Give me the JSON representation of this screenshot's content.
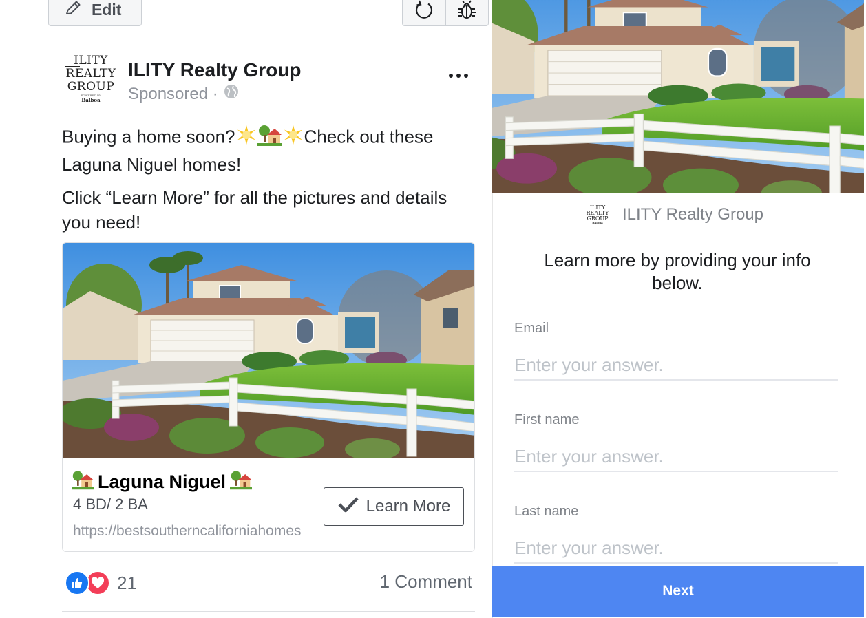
{
  "toolbar": {
    "edit_label": "Edit",
    "refresh_icon": "refresh-icon",
    "bug_icon": "bug-icon"
  },
  "post": {
    "page_logo_lines": [
      "ILITY",
      "REALTY",
      "GROUP",
      "POWERED BY",
      "Balboa"
    ],
    "page_name": "ILITY Realty Group",
    "sponsored": "Sponsored · ",
    "text_line1_a": "Buying a home soon?",
    "text_line1_b": "Check out these Laguna Niguel homes!",
    "text_line2": "Click “Learn More” for all the pictures and details you need!",
    "emojis": [
      "sun-emoji",
      "house-with-garden-emoji",
      "sun-emoji"
    ]
  },
  "card": {
    "title": "Laguna Niguel",
    "subtitle": "4 BD/ 2 BA",
    "url": "https://bestsoutherncaliforniahomes",
    "cta_label": "Learn More"
  },
  "engagement": {
    "reaction_count": "21",
    "comments": "1 Comment",
    "reactions": [
      "like-icon",
      "love-icon"
    ]
  },
  "lead_form": {
    "brand_name": "ILITY Realty Group",
    "heading": "Learn more by providing your info below.",
    "fields": [
      {
        "label": "Email",
        "placeholder": "Enter your answer."
      },
      {
        "label": "First name",
        "placeholder": "Enter your answer."
      },
      {
        "label": "Last name",
        "placeholder": "Enter your answer."
      }
    ],
    "next_label": "Next"
  },
  "colors": {
    "accent_blue": "#4e86f2",
    "like_blue": "#1877f2",
    "love_red": "#f33e58",
    "text_dark": "#1c1e21",
    "text_muted": "#90949c"
  }
}
